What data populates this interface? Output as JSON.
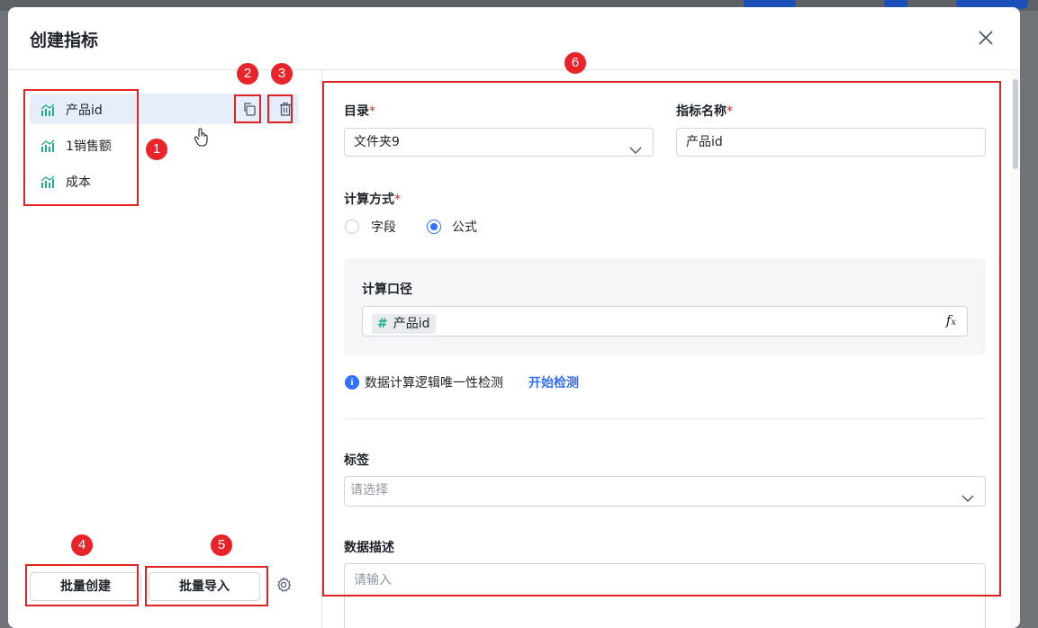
{
  "modal": {
    "title": "创建指标",
    "close_icon": "close-icon"
  },
  "metrics": [
    {
      "label": "产品id",
      "icon": "metric-chart-icon",
      "active": true
    },
    {
      "label": "1销售额",
      "icon": "metric-chart-icon",
      "active": false
    },
    {
      "label": "成本",
      "icon": "metric-chart-icon",
      "active": false
    }
  ],
  "item_actions": {
    "copy_icon": "copy-icon",
    "delete_icon": "trash-icon"
  },
  "footer": {
    "batch_create": "批量创建",
    "batch_import": "批量导入",
    "settings_icon": "gear-icon"
  },
  "annotations": [
    "1",
    "2",
    "3",
    "4",
    "5",
    "6"
  ],
  "form": {
    "catalog": {
      "label": "目录",
      "required_mark": "*",
      "value": "文件夹9"
    },
    "metric_name": {
      "label": "指标名称",
      "required_mark": "*",
      "value": "产品id"
    },
    "calc_method": {
      "label": "计算方式",
      "required_mark": "*",
      "options": [
        "字段",
        "公式"
      ],
      "selected": "公式"
    },
    "formula": {
      "label": "计算口径",
      "token": "产品id",
      "token_icon": "#",
      "fx_icon": "fx-icon"
    },
    "check": {
      "text": "数据计算逻辑唯一性检测",
      "link": "开始检测",
      "info_icon": "info-icon"
    },
    "tags": {
      "label": "标签",
      "placeholder": "请选择"
    },
    "description": {
      "label": "数据描述",
      "placeholder": "请输入"
    }
  },
  "colors": {
    "accent": "#3370ff",
    "annotation": "#e02424",
    "metric_icon": "#1fae8c"
  }
}
